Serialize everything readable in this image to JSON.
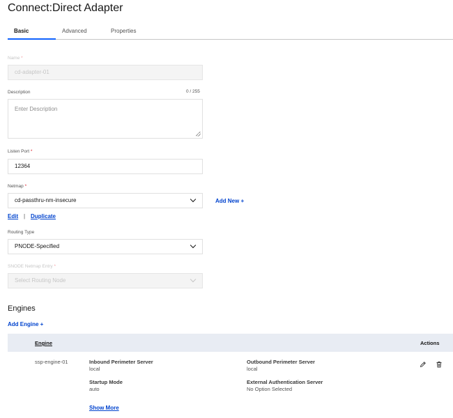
{
  "page": {
    "title": "Connect:Direct Adapter"
  },
  "tabs": [
    {
      "label": "Basic",
      "active": true
    },
    {
      "label": "Advanced",
      "active": false
    },
    {
      "label": "Properties",
      "active": false
    }
  ],
  "form": {
    "name": {
      "label": "Name",
      "required_mark": "*",
      "value": "cd-adapter-01",
      "disabled": true
    },
    "description": {
      "label": "Description",
      "counter": "0 / 255",
      "placeholder": "Enter Description"
    },
    "listen_port": {
      "label": "Listen Port",
      "required_mark": "*",
      "value": "12364"
    },
    "netmap": {
      "label": "Netmap",
      "required_mark": "*",
      "value": "cd-passthru-nm-insecure",
      "add_new": "Add New +",
      "edit": "Edit",
      "separator": "|",
      "duplicate": "Duplicate"
    },
    "routing_type": {
      "label": "Routing Type",
      "value": "PNODE-Specified"
    },
    "snode_entry": {
      "label": "SNODE Netmap Entry",
      "required_mark": "*",
      "placeholder": "Select Routing Node",
      "disabled": true
    }
  },
  "engines": {
    "title": "Engines",
    "add_label": "Add Engine +",
    "columns": {
      "engine": "Engine",
      "actions": "Actions"
    },
    "rows": [
      {
        "name": "ssp-engine-01",
        "inbound_key": "Inbound Perimeter Server",
        "inbound_val": "local",
        "outbound_key": "Outbound Perimeter Server",
        "outbound_val": "local",
        "startup_key": "Startup Mode",
        "startup_val": "auto",
        "extauth_key": "External Authentication Server",
        "extauth_val": "No Option Selected",
        "show_more": "Show More"
      }
    ]
  },
  "icons": {
    "edit": "pencil-icon",
    "delete": "trash-icon",
    "dropdown": "chevron-down-icon",
    "resize": "resize-grip-icon"
  },
  "colors": {
    "accent": "#0f62fe",
    "required": "#da1e28",
    "table_header": "#e8ecf3"
  }
}
